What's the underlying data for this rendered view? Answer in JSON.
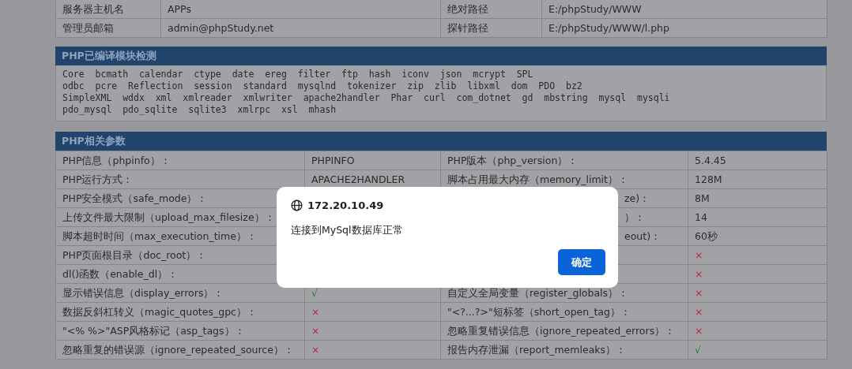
{
  "server_table": {
    "rows": [
      [
        "服务器主机名",
        "APPs",
        "绝对路径",
        "E:/phpStudy/WWW"
      ],
      [
        "管理员邮箱",
        "admin@phpStudy.net",
        "探针路径",
        "E:/phpStudy/WWW/l.php"
      ]
    ]
  },
  "modules": {
    "title": "PHP已编译模块检测",
    "lines": [
      "Core  bcmath  calendar  ctype  date  ereg  filter  ftp  hash  iconv  json  mcrypt  SPL",
      "odbc  pcre  Reflection  session  standard  mysqlnd  tokenizer  zip  zlib  libxml  dom  PDO  bz2",
      "SimpleXML  wddx  xml  xmlreader  xmlwriter  apache2handler  Phar  curl  com_dotnet  gd  mbstring  mysql  mysqli",
      "pdo_mysql  pdo_sqlite  sqlite3  xmlrpc  xsl  mhash"
    ]
  },
  "params": {
    "title": "PHP相关参数",
    "rows": [
      {
        "left": {
          "label": "PHP信息（phpinfo）：",
          "value": {
            "kind": "text",
            "text": "PHPINFO"
          }
        },
        "right": {
          "label": "PHP版本（php_version）：",
          "value": {
            "kind": "text",
            "text": "5.4.45"
          }
        }
      },
      {
        "left": {
          "label": "PHP运行方式：",
          "value": {
            "kind": "text",
            "text": "APACHE2HANDLER"
          }
        },
        "right": {
          "label": "脚本占用最大内存（memory_limit）：",
          "value": {
            "kind": "text",
            "text": "128M"
          }
        }
      },
      {
        "left": {
          "label": "PHP安全模式（safe_mode）："
        },
        "right": {
          "label": "ze)：",
          "cut": true,
          "value": {
            "kind": "text",
            "text": "8M"
          }
        }
      },
      {
        "left": {
          "label": "上传文件最大限制（upload_max_filesize）："
        },
        "right": {
          "label": "）：",
          "cut": true,
          "value": {
            "kind": "text",
            "text": "14"
          }
        }
      },
      {
        "left": {
          "label": "脚本超时时间（max_execution_time）："
        },
        "right": {
          "label": "eout)：",
          "cut": true,
          "value": {
            "kind": "text",
            "text": "60秒"
          }
        }
      },
      {
        "left": {
          "label": "PHP页面根目录（doc_root）："
        },
        "right": {
          "value": {
            "kind": "no",
            "text": "×"
          }
        }
      },
      {
        "left": {
          "label": "dl()函数（enable_dl）："
        },
        "right": {
          "value": {
            "kind": "no",
            "text": "×"
          }
        }
      },
      {
        "left": {
          "label": "显示错误信息（display_errors）：",
          "value": {
            "kind": "yes",
            "text": "√"
          }
        },
        "right": {
          "label": "自定义全局变量（register_globals）：",
          "value": {
            "kind": "no",
            "text": "×"
          }
        }
      },
      {
        "left": {
          "label": "数据反斜杠转义（magic_quotes_gpc）：",
          "value": {
            "kind": "no",
            "text": "×"
          }
        },
        "right": {
          "label": "\"<?...?>\"短标签（short_open_tag）：",
          "value": {
            "kind": "no",
            "text": "×"
          }
        }
      },
      {
        "left": {
          "label": "\"<% %>\"ASP风格标记（asp_tags）：",
          "value": {
            "kind": "no",
            "text": "×"
          }
        },
        "right": {
          "label": "忽略重复错误信息（ignore_repeated_errors）：",
          "value": {
            "kind": "no",
            "text": "×"
          }
        }
      },
      {
        "left": {
          "label": "忽略重复的错误源（ignore_repeated_source）：",
          "value": {
            "kind": "no",
            "text": "×"
          }
        },
        "right": {
          "label": "报告内存泄漏（report_memleaks）：",
          "value": {
            "kind": "yes",
            "text": "√"
          }
        }
      }
    ]
  },
  "dialog": {
    "origin": "172.20.10.49",
    "message": "连接到MySql数据库正常",
    "button": "确定"
  }
}
